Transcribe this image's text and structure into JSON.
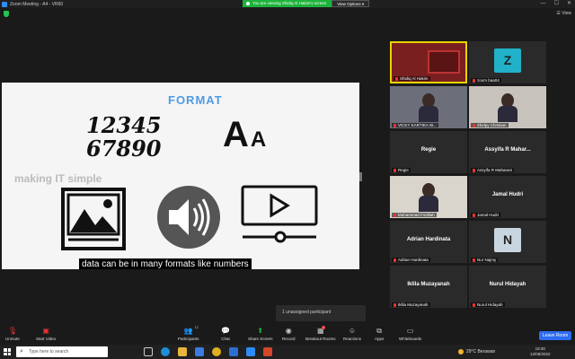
{
  "window": {
    "title": "Zoom Meeting - A4 - VR60",
    "controls": [
      "—",
      "☐",
      "✕"
    ]
  },
  "share_banner": {
    "text": "You are viewing Shidiq Al Hakim's screen",
    "view_options": "View Options ▾"
  },
  "header": {
    "view_label": "☰ View"
  },
  "shared_content": {
    "heading": "FORMAT",
    "numbers_line1": "12345",
    "numbers_line2": "67890",
    "letters_big": "A",
    "letters_small": "A",
    "tagline": "making IT simple",
    "caption": "data can be in many formats like numbers"
  },
  "gallery": [
    {
      "name": "Shidiq Al Hakim",
      "video": true,
      "active": true
    },
    {
      "name": "zoom baa04",
      "initial": "Z",
      "avatar_color": "#21b1c9"
    },
    {
      "name": "VICKY KARTIKA W...",
      "video": true
    },
    {
      "name": "Zhelpy Christian",
      "video": true
    },
    {
      "name": "Regie",
      "center": "Regie"
    },
    {
      "name": "Assyifa R Maharani",
      "center": "Assyifa R Mahar..."
    },
    {
      "name": "Muhammad Firdillah",
      "video": true
    },
    {
      "name": "Jamal Hudri",
      "center": "Jamal Hudri"
    },
    {
      "name": "Adrian Hardinata",
      "center": "Adrian Hardinata"
    },
    {
      "name": "Nur Najmy",
      "initial": "N",
      "avatar_color": "#c9d6df"
    },
    {
      "name": "Iklila Muzayanah",
      "center": "Iklila Muzayanah"
    },
    {
      "name": "Nurul Hidayah",
      "center": "Nurul Hidayah"
    }
  ],
  "popover": {
    "text": "1 unassigned participant"
  },
  "toolbar": {
    "unmute": "Unmute",
    "start_video": "Start Video",
    "participants": "Participants",
    "participants_count": "12",
    "chat": "Chat",
    "share_screen": "Share Screen",
    "record": "Record",
    "breakout_rooms": "Breakout Rooms",
    "breakout_badge": "1",
    "reactions": "Reactions",
    "apps": "Apps",
    "whiteboards": "Whiteboards",
    "leave": "Leave Room"
  },
  "taskbar": {
    "search_placeholder": "Type here to search",
    "weather": "29°C  Berawan",
    "time": "19:30",
    "date": "12/08/2022"
  }
}
